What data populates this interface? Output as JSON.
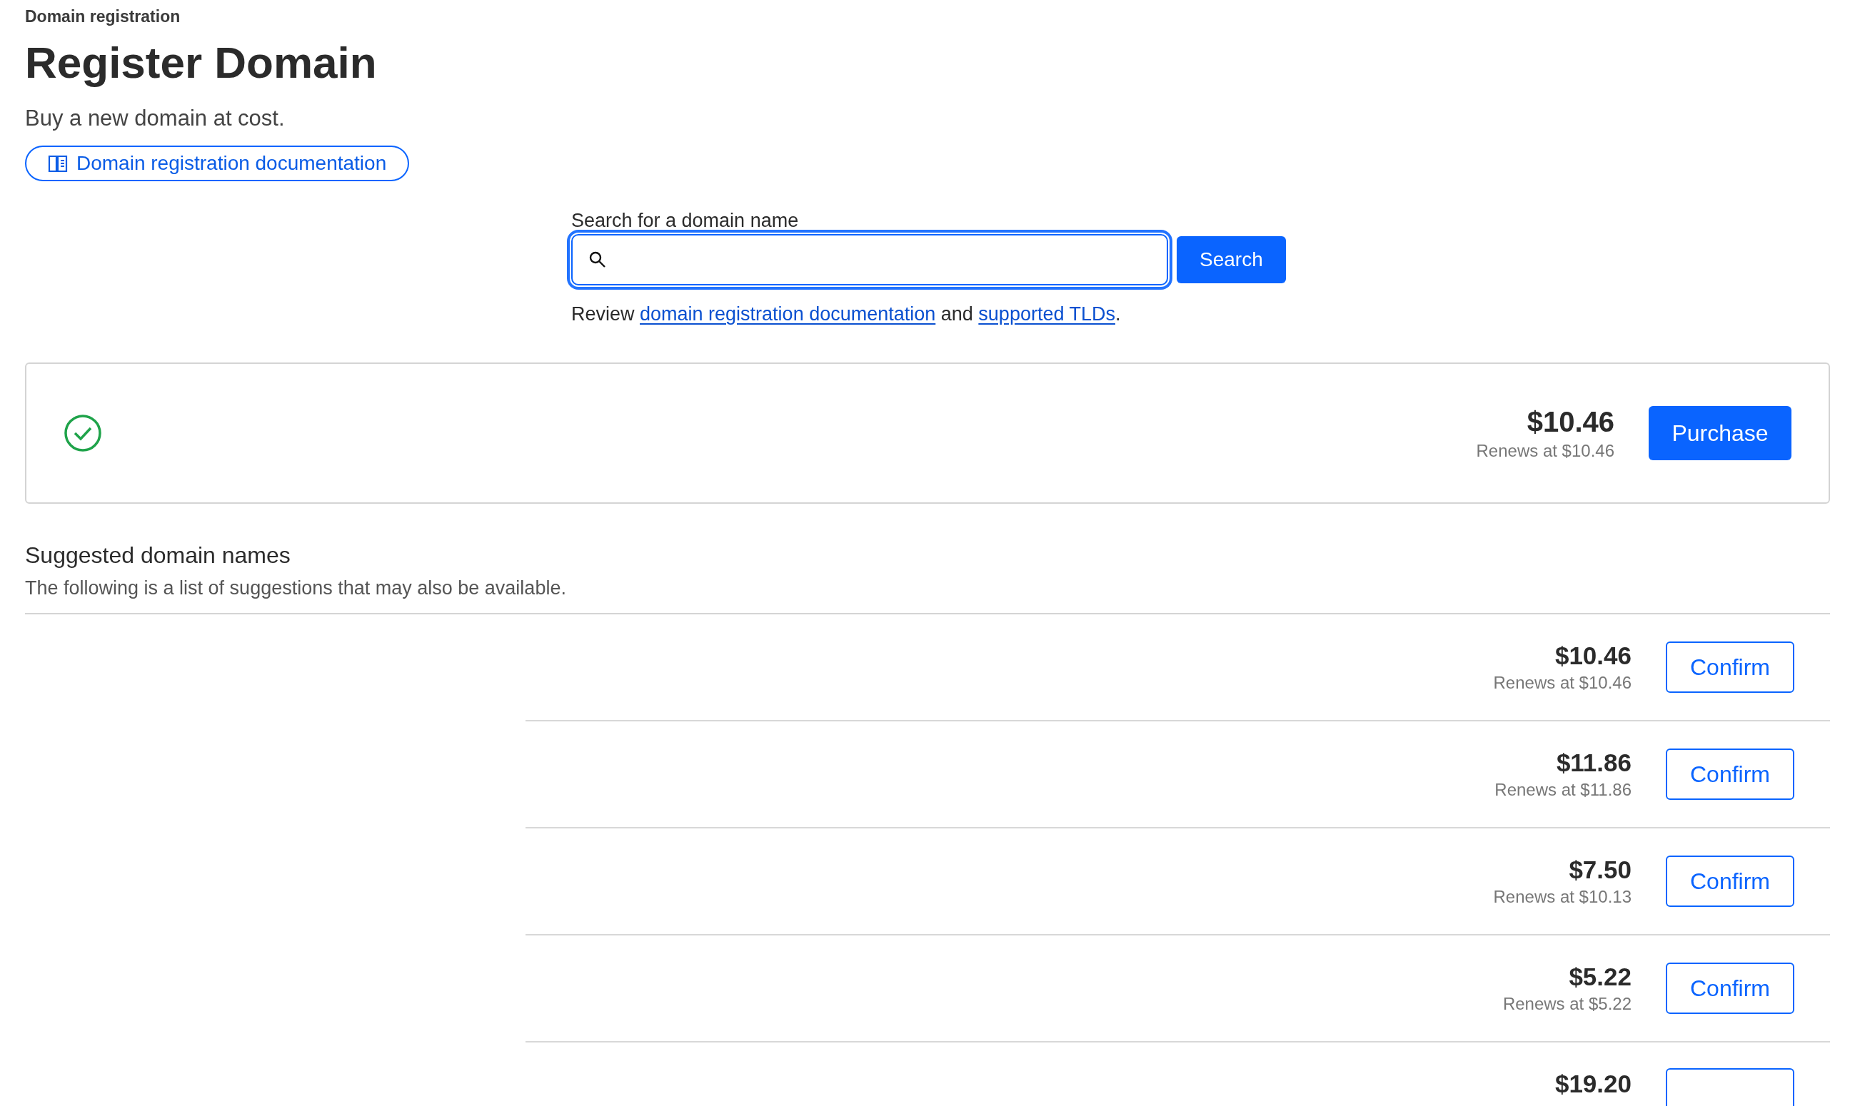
{
  "breadcrumb": "Domain registration",
  "title": "Register Domain",
  "subtitle": "Buy a new domain at cost.",
  "doc_link": "Domain registration documentation",
  "search": {
    "label": "Search for a domain name",
    "button": "Search",
    "focused": true,
    "help": [
      {
        "kind": "text",
        "text": "Review "
      },
      {
        "kind": "link",
        "text": "domain registration documentation"
      },
      {
        "kind": "text",
        "text": " and "
      },
      {
        "kind": "link",
        "text": "supported TLDs"
      },
      {
        "kind": "text",
        "text": "."
      }
    ]
  },
  "result": {
    "available": true,
    "price": "$10.46",
    "renewal": "Renews at $10.46",
    "button": "Purchase"
  },
  "suggestions": {
    "title": "Suggested domain names",
    "description": "The following is a list of suggestions that may also be available.",
    "rows": [
      {
        "price": "$10.46",
        "renewal": "Renews at $10.46",
        "button": "Confirm"
      },
      {
        "price": "$11.86",
        "renewal": "Renews at $11.86",
        "button": "Confirm"
      },
      {
        "price": "$7.50",
        "renewal": "Renews at $10.13",
        "button": "Confirm"
      },
      {
        "price": "$5.22",
        "renewal": "Renews at $5.22",
        "button": "Confirm"
      },
      {
        "price": "$19.20"
      }
    ]
  }
}
